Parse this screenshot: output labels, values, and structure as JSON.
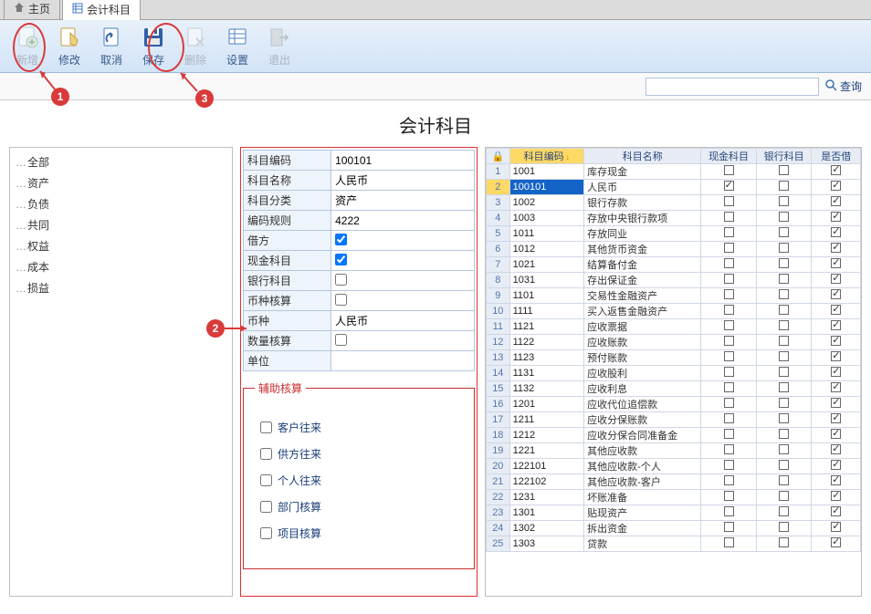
{
  "tabs": {
    "home": "主页",
    "active": "会计科目"
  },
  "toolbar": {
    "add": "新增",
    "edit": "修改",
    "cancel": "取消",
    "save": "保存",
    "delete": "删除",
    "settings": "设置",
    "exit": "退出"
  },
  "search": {
    "placeholder": "",
    "button": "查询"
  },
  "page_title": "会计科目",
  "sidebar": {
    "items": [
      "全部",
      "资产",
      "负债",
      "共同",
      "权益",
      "成本",
      "损益"
    ]
  },
  "form": {
    "rows": [
      {
        "label": "科目编码",
        "value": "100101",
        "type": "text"
      },
      {
        "label": "科目名称",
        "value": "人民币",
        "type": "text"
      },
      {
        "label": "科目分类",
        "value": "资产",
        "type": "text"
      },
      {
        "label": "编码规则",
        "value": "4222",
        "type": "text"
      },
      {
        "label": "借方",
        "value": "",
        "type": "checkbox",
        "checked": true
      },
      {
        "label": "现金科目",
        "value": "",
        "type": "checkbox",
        "checked": true
      },
      {
        "label": "银行科目",
        "value": "",
        "type": "checkbox",
        "checked": false
      },
      {
        "label": "币种核算",
        "value": "",
        "type": "checkbox",
        "checked": false
      },
      {
        "label": "币种",
        "value": "人民币",
        "type": "text"
      },
      {
        "label": "数量核算",
        "value": "",
        "type": "checkbox",
        "checked": false
      },
      {
        "label": "单位",
        "value": "",
        "type": "text"
      }
    ],
    "aux": {
      "title": "辅助核算",
      "items": [
        "客户往来",
        "供方往来",
        "个人往来",
        "部门核算",
        "项目核算"
      ]
    }
  },
  "grid": {
    "headers": {
      "lock": "🔒",
      "code": "科目编码",
      "name": "科目名称",
      "cash": "现金科目",
      "bank": "银行科目",
      "debit": "是否借"
    },
    "rows": [
      {
        "n": 1,
        "code": "1001",
        "name": "库存现金",
        "cash": false,
        "bank": false,
        "debit": true,
        "sel": false
      },
      {
        "n": 2,
        "code": "100101",
        "name": "人民币",
        "cash": true,
        "bank": false,
        "debit": true,
        "sel": true
      },
      {
        "n": 3,
        "code": "1002",
        "name": "银行存款",
        "cash": false,
        "bank": false,
        "debit": true,
        "sel": false
      },
      {
        "n": 4,
        "code": "1003",
        "name": "存放中央银行款项",
        "cash": false,
        "bank": false,
        "debit": true,
        "sel": false
      },
      {
        "n": 5,
        "code": "1011",
        "name": "存放同业",
        "cash": false,
        "bank": false,
        "debit": true,
        "sel": false
      },
      {
        "n": 6,
        "code": "1012",
        "name": "其他货币资金",
        "cash": false,
        "bank": false,
        "debit": true,
        "sel": false
      },
      {
        "n": 7,
        "code": "1021",
        "name": "结算备付金",
        "cash": false,
        "bank": false,
        "debit": true,
        "sel": false
      },
      {
        "n": 8,
        "code": "1031",
        "name": "存出保证金",
        "cash": false,
        "bank": false,
        "debit": true,
        "sel": false
      },
      {
        "n": 9,
        "code": "1101",
        "name": "交易性金融资产",
        "cash": false,
        "bank": false,
        "debit": true,
        "sel": false
      },
      {
        "n": 10,
        "code": "1111",
        "name": "买入返售金融资产",
        "cash": false,
        "bank": false,
        "debit": true,
        "sel": false
      },
      {
        "n": 11,
        "code": "1121",
        "name": "应收票据",
        "cash": false,
        "bank": false,
        "debit": true,
        "sel": false
      },
      {
        "n": 12,
        "code": "1122",
        "name": "应收账款",
        "cash": false,
        "bank": false,
        "debit": true,
        "sel": false
      },
      {
        "n": 13,
        "code": "1123",
        "name": "预付账款",
        "cash": false,
        "bank": false,
        "debit": true,
        "sel": false
      },
      {
        "n": 14,
        "code": "1131",
        "name": "应收股利",
        "cash": false,
        "bank": false,
        "debit": true,
        "sel": false
      },
      {
        "n": 15,
        "code": "1132",
        "name": "应收利息",
        "cash": false,
        "bank": false,
        "debit": true,
        "sel": false
      },
      {
        "n": 16,
        "code": "1201",
        "name": "应收代位追偿款",
        "cash": false,
        "bank": false,
        "debit": true,
        "sel": false
      },
      {
        "n": 17,
        "code": "1211",
        "name": "应收分保账款",
        "cash": false,
        "bank": false,
        "debit": true,
        "sel": false
      },
      {
        "n": 18,
        "code": "1212",
        "name": "应收分保合同准备金",
        "cash": false,
        "bank": false,
        "debit": true,
        "sel": false
      },
      {
        "n": 19,
        "code": "1221",
        "name": "其他应收款",
        "cash": false,
        "bank": false,
        "debit": true,
        "sel": false
      },
      {
        "n": 20,
        "code": "122101",
        "name": "其他应收款-个人",
        "cash": false,
        "bank": false,
        "debit": true,
        "sel": false
      },
      {
        "n": 21,
        "code": "122102",
        "name": "其他应收款-客户",
        "cash": false,
        "bank": false,
        "debit": true,
        "sel": false
      },
      {
        "n": 22,
        "code": "1231",
        "name": "坏账准备",
        "cash": false,
        "bank": false,
        "debit": true,
        "sel": false
      },
      {
        "n": 23,
        "code": "1301",
        "name": "贴现资产",
        "cash": false,
        "bank": false,
        "debit": true,
        "sel": false
      },
      {
        "n": 24,
        "code": "1302",
        "name": "拆出资金",
        "cash": false,
        "bank": false,
        "debit": true,
        "sel": false
      },
      {
        "n": 25,
        "code": "1303",
        "name": "贷款",
        "cash": false,
        "bank": false,
        "debit": true,
        "sel": false
      }
    ]
  },
  "callouts": {
    "c1": "1",
    "c2": "2",
    "c3": "3"
  }
}
